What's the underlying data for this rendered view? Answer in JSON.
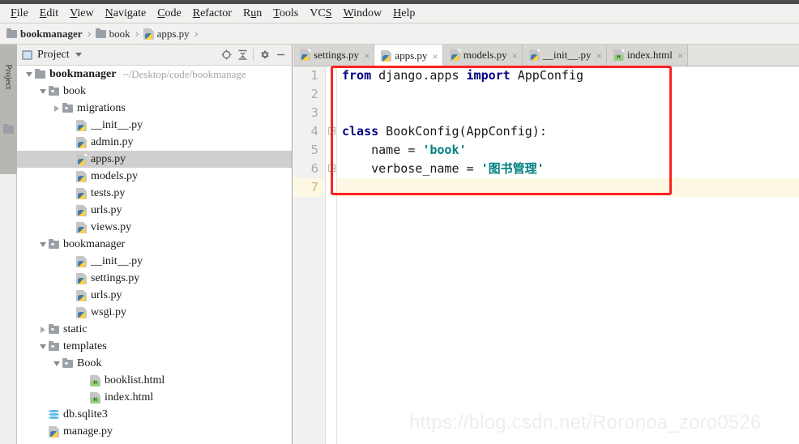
{
  "menubar": {
    "items": [
      {
        "label": "File",
        "mnemonic": "F"
      },
      {
        "label": "Edit",
        "mnemonic": "E"
      },
      {
        "label": "View",
        "mnemonic": "V"
      },
      {
        "label": "Navigate",
        "mnemonic": "N"
      },
      {
        "label": "Code",
        "mnemonic": "C"
      },
      {
        "label": "Refactor",
        "mnemonic": "R"
      },
      {
        "label": "Run",
        "mnemonic": "u"
      },
      {
        "label": "Tools",
        "mnemonic": "T"
      },
      {
        "label": "VCS",
        "mnemonic": "S"
      },
      {
        "label": "Window",
        "mnemonic": "W"
      },
      {
        "label": "Help",
        "mnemonic": "H"
      }
    ]
  },
  "breadcrumb": {
    "items": [
      {
        "label": "bookmanager",
        "icon": "folder-icon",
        "bold": true
      },
      {
        "label": "book",
        "icon": "folder-icon",
        "bold": false
      },
      {
        "label": "apps.py",
        "icon": "python-file-icon",
        "bold": false
      }
    ],
    "separator": "›"
  },
  "toolstrip": {
    "label": "Project",
    "folder_icon": "folder-icon"
  },
  "project_panel": {
    "title": "Project",
    "title_icon": "project-icon",
    "caret_icon": "chevron-down-icon",
    "buttons": [
      {
        "name": "locate-icon",
        "glyph": "⊕"
      },
      {
        "name": "collapse-all-icon",
        "glyph": "≔"
      },
      {
        "name": "gear-icon",
        "glyph": "⚙"
      },
      {
        "name": "minimize-icon",
        "glyph": "—"
      }
    ],
    "tree": [
      {
        "label": "bookmanager",
        "path": "~/Desktop/code/bookmanage",
        "indent": 0,
        "twisty": "down",
        "icon": "folder-icon",
        "bold": true,
        "selected": false
      },
      {
        "label": "book",
        "indent": 1,
        "twisty": "down",
        "icon": "folder-open-icon",
        "bold": false,
        "selected": false
      },
      {
        "label": "migrations",
        "indent": 2,
        "twisty": "right",
        "icon": "folder-open-icon",
        "bold": false,
        "selected": false
      },
      {
        "label": "__init__.py",
        "indent": 3,
        "twisty": "none",
        "icon": "python-file-icon",
        "bold": false,
        "selected": false
      },
      {
        "label": "admin.py",
        "indent": 3,
        "twisty": "none",
        "icon": "python-file-icon",
        "bold": false,
        "selected": false
      },
      {
        "label": "apps.py",
        "indent": 3,
        "twisty": "none",
        "icon": "python-file-icon",
        "bold": false,
        "selected": true
      },
      {
        "label": "models.py",
        "indent": 3,
        "twisty": "none",
        "icon": "python-file-icon",
        "bold": false,
        "selected": false
      },
      {
        "label": "tests.py",
        "indent": 3,
        "twisty": "none",
        "icon": "python-file-icon",
        "bold": false,
        "selected": false
      },
      {
        "label": "urls.py",
        "indent": 3,
        "twisty": "none",
        "icon": "python-file-icon",
        "bold": false,
        "selected": false
      },
      {
        "label": "views.py",
        "indent": 3,
        "twisty": "none",
        "icon": "python-file-icon",
        "bold": false,
        "selected": false
      },
      {
        "label": "bookmanager",
        "indent": 1,
        "twisty": "down",
        "icon": "folder-open-icon",
        "bold": false,
        "selected": false
      },
      {
        "label": "__init__.py",
        "indent": 3,
        "twisty": "none",
        "icon": "python-file-icon",
        "bold": false,
        "selected": false
      },
      {
        "label": "settings.py",
        "indent": 3,
        "twisty": "none",
        "icon": "python-file-icon",
        "bold": false,
        "selected": false
      },
      {
        "label": "urls.py",
        "indent": 3,
        "twisty": "none",
        "icon": "python-file-icon",
        "bold": false,
        "selected": false
      },
      {
        "label": "wsgi.py",
        "indent": 3,
        "twisty": "none",
        "icon": "python-file-icon",
        "bold": false,
        "selected": false
      },
      {
        "label": "static",
        "indent": 1,
        "twisty": "right",
        "icon": "folder-open-icon",
        "bold": false,
        "selected": false
      },
      {
        "label": "templates",
        "indent": 1,
        "twisty": "down",
        "icon": "folder-open-icon",
        "bold": false,
        "selected": false
      },
      {
        "label": "Book",
        "indent": 2,
        "twisty": "down",
        "icon": "folder-open-icon",
        "bold": false,
        "selected": false
      },
      {
        "label": "booklist.html",
        "indent": 4,
        "twisty": "none",
        "icon": "html-file-icon",
        "bold": false,
        "selected": false
      },
      {
        "label": "index.html",
        "indent": 4,
        "twisty": "none",
        "icon": "html-file-icon",
        "bold": false,
        "selected": false
      },
      {
        "label": "db.sqlite3",
        "indent": 1,
        "twisty": "none",
        "icon": "database-icon",
        "bold": false,
        "selected": false
      },
      {
        "label": "manage.py",
        "indent": 1,
        "twisty": "none",
        "icon": "python-file-icon",
        "bold": false,
        "selected": false
      }
    ]
  },
  "editor": {
    "tabs": [
      {
        "label": "settings.py",
        "icon": "python-file-icon",
        "active": false,
        "close": "×"
      },
      {
        "label": "apps.py",
        "icon": "python-file-icon",
        "active": true,
        "close": "×"
      },
      {
        "label": "models.py",
        "icon": "python-file-icon",
        "active": false,
        "close": "×"
      },
      {
        "label": "__init__.py",
        "icon": "python-file-icon",
        "active": false,
        "close": "×"
      },
      {
        "label": "index.html",
        "icon": "html-file-icon",
        "active": false,
        "close": "×"
      }
    ],
    "line_numbers": [
      "1",
      "2",
      "3",
      "4",
      "5",
      "6",
      "7"
    ],
    "current_line": 7,
    "code_lines": [
      {
        "n": 1,
        "tokens": [
          {
            "t": "from",
            "c": "kw"
          },
          {
            "t": " django.apps ",
            "c": "pln"
          },
          {
            "t": "import",
            "c": "kw"
          },
          {
            "t": " AppConfig",
            "c": "pln"
          }
        ]
      },
      {
        "n": 2,
        "tokens": []
      },
      {
        "n": 3,
        "tokens": []
      },
      {
        "n": 4,
        "tokens": [
          {
            "t": "class",
            "c": "kw"
          },
          {
            "t": " BookConfig(AppConfig):",
            "c": "pln"
          }
        ]
      },
      {
        "n": 5,
        "tokens": [
          {
            "t": "    name = ",
            "c": "pln"
          },
          {
            "t": "'book'",
            "c": "str"
          }
        ]
      },
      {
        "n": 6,
        "tokens": [
          {
            "t": "    verbose_name = ",
            "c": "pln"
          },
          {
            "t": "'图书管理'",
            "c": "str"
          }
        ]
      },
      {
        "n": 7,
        "tokens": []
      }
    ]
  },
  "annotation": {
    "box_color": "#fb2222"
  },
  "watermark": {
    "text": "https://blog.csdn.net/Roronoa_zoro0526"
  },
  "colors": {
    "keyword": "#000080",
    "string": "#008080",
    "plain": "#1a1a1a",
    "current_line_bg": "#fdf8e3",
    "selection_bg": "#cfcfcf",
    "annotation_red": "#fb2222"
  }
}
